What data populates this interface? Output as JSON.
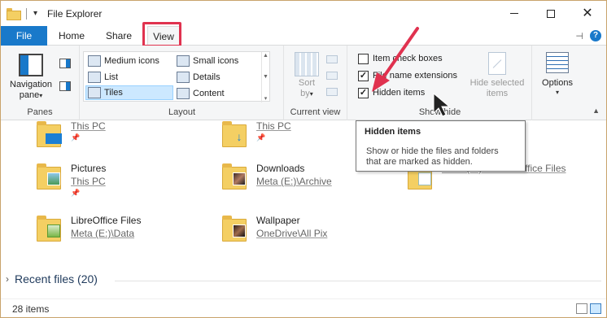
{
  "window": {
    "title": "File Explorer"
  },
  "tabs": {
    "file": "File",
    "home": "Home",
    "share": "Share",
    "view": "View"
  },
  "ribbon": {
    "panes": {
      "navigation_pane": "Navigation",
      "navigation_pane_line2": "pane",
      "label": "Panes"
    },
    "layout": {
      "items": [
        {
          "label": "Medium icons"
        },
        {
          "label": "Small icons"
        },
        {
          "label": "List"
        },
        {
          "label": "Details"
        },
        {
          "label": "Tiles"
        },
        {
          "label": "Content"
        }
      ],
      "selected": "Tiles",
      "label": "Layout"
    },
    "current_view": {
      "sort_by": "Sort",
      "sort_by_line2": "by",
      "label": "Current view"
    },
    "show_hide": {
      "item_check_boxes": {
        "label": "Item check boxes",
        "checked": false
      },
      "file_name_extensions": {
        "label": "File name extensions",
        "checked": true
      },
      "hidden_items": {
        "label": "Hidden items",
        "checked": true
      },
      "hide_selected": "Hide selected",
      "hide_selected_line2": "items",
      "label": "Show/hide"
    },
    "options": {
      "label": "Options"
    }
  },
  "content": {
    "tiles": [
      {
        "name": "",
        "path": "This PC",
        "pinned": true
      },
      {
        "name": "",
        "path": "This PC",
        "pinned": true
      },
      {
        "name": "Pictures",
        "path": "This PC",
        "pinned": true
      },
      {
        "name": "Downloads",
        "path": "Meta (E:)\\Archive",
        "pinned": false
      },
      {
        "name": "",
        "path": "Meta (E:)\\...\\LibreOffice Files",
        "pinned": false
      },
      {
        "name": "LibreOffice Files",
        "path": "Meta (E:)\\Data",
        "pinned": false
      },
      {
        "name": "Wallpaper",
        "path": "OneDrive\\All Pix",
        "pinned": false
      }
    ],
    "recent": "Recent files (20)"
  },
  "tooltip": {
    "title": "Hidden items",
    "body_line1": "Show or hide the files and folders",
    "body_line2": "that are marked as hidden."
  },
  "status": {
    "items": "28 items"
  },
  "colors": {
    "accent": "#1979ca",
    "highlight": "#e0324f",
    "folder": "#f4cf63"
  }
}
